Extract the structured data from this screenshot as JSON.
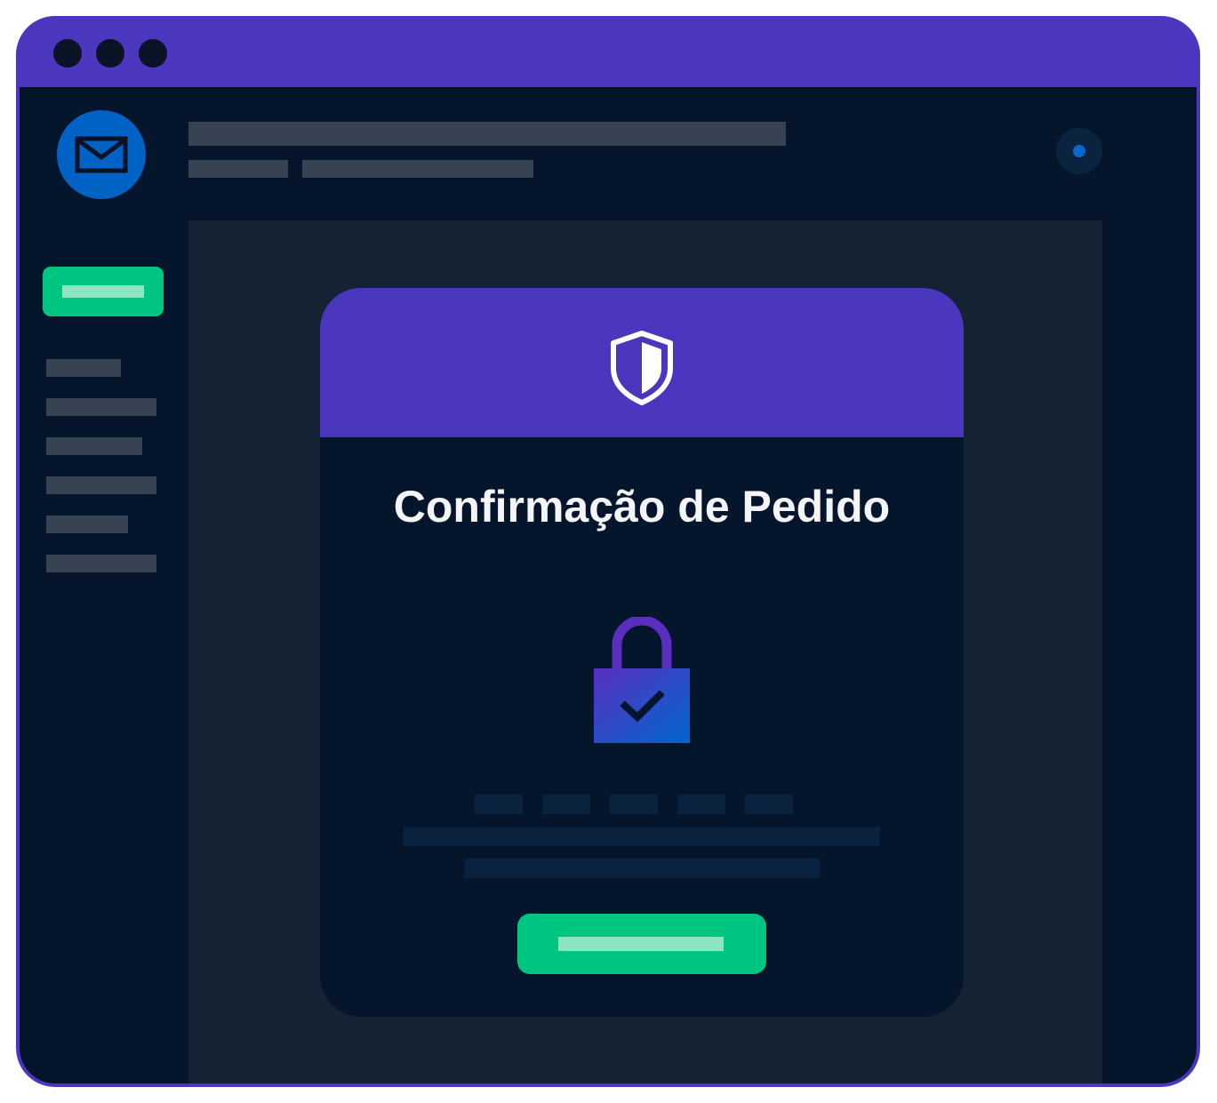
{
  "window": {
    "controls": [
      "window-dot",
      "window-dot",
      "window-dot"
    ]
  },
  "app": {
    "logo_icon": "envelope-icon",
    "status_icon": "status-dot-icon"
  },
  "dialog": {
    "header_icon": "shield-icon",
    "title": "Confirmação de Pedido",
    "status_icon": "padlock-check-icon"
  },
  "colors": {
    "accent": "#4b37bd",
    "background": "#05152b",
    "panel": "#142234",
    "primary_action": "#00c581",
    "brand_blue": "#0062c4"
  }
}
